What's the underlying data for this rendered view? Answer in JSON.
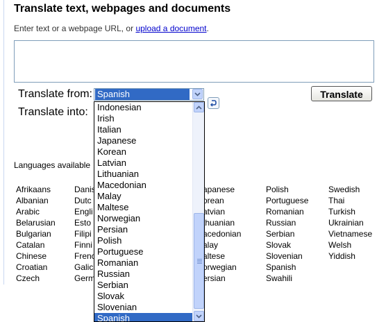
{
  "title": "Translate text, webpages and documents",
  "hint": {
    "text": "Enter text or a webpage URL, or ",
    "link": "upload a document",
    "end": "."
  },
  "textbox": {
    "value": ""
  },
  "from_label": "Translate from:",
  "into_label": "Translate into:",
  "from_selected": "Spanish",
  "translate_button": "Translate",
  "available_label": "Languages available",
  "dropdown_options": [
    "Indonesian",
    "Irish",
    "Italian",
    "Japanese",
    "Korean",
    "Latvian",
    "Lithuanian",
    "Macedonian",
    "Malay",
    "Maltese",
    "Norwegian",
    "Persian",
    "Polish",
    "Portuguese",
    "Romanian",
    "Russian",
    "Serbian",
    "Slovak",
    "Slovenian",
    "Spanish"
  ],
  "dropdown_selected_index": 19,
  "languages": {
    "col1": [
      "Afrikaans",
      "Albanian",
      "Arabic",
      "Belarusian",
      "Bulgarian",
      "Catalan",
      "Chinese",
      "Croatian",
      "Czech"
    ],
    "col2": [
      "Danis",
      "Dutc",
      "Engli",
      "Esto",
      "Filipi",
      "Finni",
      "Frenc",
      "Galic",
      "Germ"
    ],
    "col4": [
      "apanese",
      "orean",
      "atvian",
      "thuanian",
      "acedonian",
      "alay",
      "altese",
      "orwegian",
      "ersian"
    ],
    "col5": [
      "Polish",
      "Portuguese",
      "Romanian",
      "Russian",
      "Serbian",
      "Slovak",
      "Slovenian",
      "Spanish",
      "Swahili"
    ],
    "col6": [
      "Swedish",
      "Thai",
      "Turkish",
      "Ukrainian",
      "Vietnamese",
      "Welsh",
      "Yiddish"
    ]
  },
  "colors": {
    "link": "#0000cc",
    "selection": "#316ac5",
    "scroll_button": "#c1d3fb"
  }
}
